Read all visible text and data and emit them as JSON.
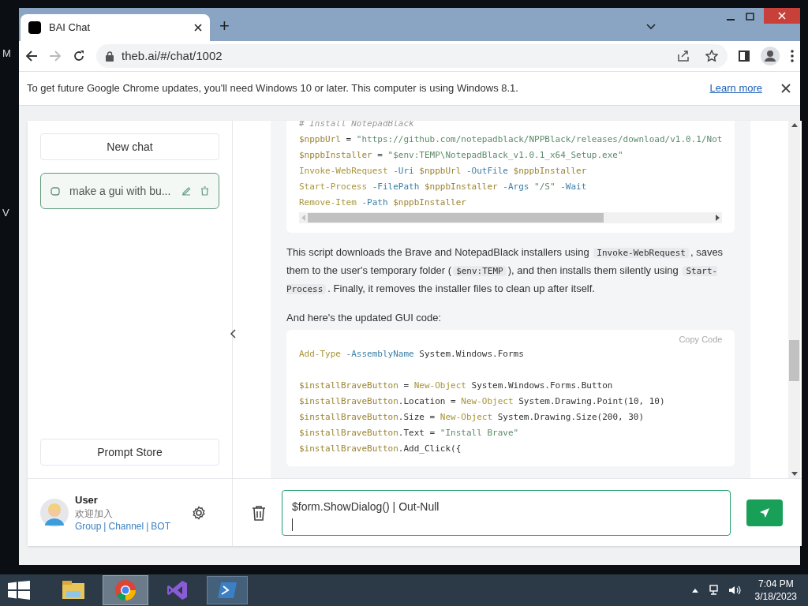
{
  "desktop": {
    "icon_labels": [
      "M",
      "V"
    ]
  },
  "browser": {
    "tabs": [
      {
        "title": "BAI Chat",
        "selected": true
      }
    ],
    "new_tab": "+",
    "url": "theb.ai/#/chat/1002",
    "infobar": {
      "text": "To get future Google Chrome updates, you'll need Windows 10 or later. This computer is using Windows 8.1.",
      "link": "Learn more"
    }
  },
  "sidebar": {
    "new_chat": "New chat",
    "chats": [
      {
        "title": "make a gui with bu...",
        "selected": true
      }
    ],
    "prompt_store": "Prompt Store",
    "user": {
      "name": "User",
      "welcome": "欢迎加入",
      "links": [
        {
          "text": "Group",
          "separator": "|"
        },
        {
          "text": "Channel",
          "separator": "|"
        },
        {
          "text": "BOT"
        }
      ]
    }
  },
  "messages": [
    {
      "kind": "code",
      "h_scroll": true,
      "lines": [
        {
          "kind": "code",
          "tokens": [
            {
              "kind": "comment",
              "t": "# Install NotepadBlack"
            }
          ]
        },
        {
          "kind": "code",
          "tokens": [
            {
              "kind": "var",
              "t": "$nppbUrl"
            },
            {
              "kind": "plain",
              "t": " = "
            },
            {
              "kind": "str",
              "t": "\"https://github.com/notepadblack/NPPBlack/releases/download/v1.0.1/Not"
            }
          ]
        },
        {
          "kind": "code",
          "tokens": [
            {
              "kind": "var",
              "t": "$nppbInstaller"
            },
            {
              "kind": "plain",
              "t": " = "
            },
            {
              "kind": "str",
              "t": "\"$env:TEMP\\NotepadBlack_v1.0.1_x64_Setup.exe\""
            }
          ]
        },
        {
          "kind": "code",
          "tokens": [
            {
              "kind": "cmd",
              "t": "Invoke-WebRequest"
            },
            {
              "kind": "param",
              "t": " -Uri "
            },
            {
              "kind": "var",
              "t": "$nppbUrl"
            },
            {
              "kind": "param",
              "t": " -OutFile "
            },
            {
              "kind": "var",
              "t": "$nppbInstaller"
            }
          ]
        },
        {
          "kind": "code",
          "tokens": [
            {
              "kind": "cmd",
              "t": "Start-Process"
            },
            {
              "kind": "param",
              "t": " -FilePath "
            },
            {
              "kind": "var",
              "t": "$nppbInstaller"
            },
            {
              "kind": "param",
              "t": " -Args "
            },
            {
              "kind": "str",
              "t": "\"/S\""
            },
            {
              "kind": "param",
              "t": " -Wait"
            }
          ]
        },
        {
          "kind": "code",
          "tokens": [
            {
              "kind": "cmd",
              "t": "Remove-Item"
            },
            {
              "kind": "param",
              "t": " -Path "
            },
            {
              "kind": "var",
              "t": "$nppbInstaller"
            }
          ]
        }
      ]
    },
    {
      "kind": "text",
      "parts": [
        {
          "kind": "text",
          "t": "This script downloads the Brave and NotepadBlack installers using "
        },
        {
          "kind": "code",
          "t": "Invoke-WebRequest"
        },
        {
          "kind": "text",
          "t": ", saves them to the user's temporary folder ("
        },
        {
          "kind": "code",
          "t": "$env:TEMP"
        },
        {
          "kind": "text",
          "t": "), and then installs them silently using "
        },
        {
          "kind": "code",
          "t": "Start-Process"
        },
        {
          "kind": "text",
          "t": ". Finally, it removes the installer files to clean up after itself."
        }
      ]
    },
    {
      "kind": "text",
      "parts": [
        {
          "kind": "text",
          "t": "And here's the updated GUI code:"
        }
      ]
    },
    {
      "kind": "code",
      "copy": "Copy  Code",
      "lines": [
        {
          "kind": "code",
          "tokens": [
            {
              "kind": "cmd",
              "t": "Add-Type"
            },
            {
              "kind": "param",
              "t": " -AssemblyName"
            },
            {
              "kind": "plain",
              "t": " System.Windows.Forms"
            }
          ]
        },
        {
          "kind": "blank"
        },
        {
          "kind": "code",
          "tokens": [
            {
              "kind": "var",
              "t": "$installBraveButton"
            },
            {
              "kind": "plain",
              "t": " = "
            },
            {
              "kind": "cmd",
              "t": "New-Object"
            },
            {
              "kind": "plain",
              "t": " System.Windows.Forms.Button"
            }
          ]
        },
        {
          "kind": "code",
          "tokens": [
            {
              "kind": "var",
              "t": "$installBraveButton"
            },
            {
              "kind": "plain",
              "t": ".Location = "
            },
            {
              "kind": "cmd",
              "t": "New-Object"
            },
            {
              "kind": "plain",
              "t": " System.Drawing.Point(10, 10)"
            }
          ]
        },
        {
          "kind": "code",
          "tokens": [
            {
              "kind": "var",
              "t": "$installBraveButton"
            },
            {
              "kind": "plain",
              "t": ".Size = "
            },
            {
              "kind": "cmd",
              "t": "New-Object"
            },
            {
              "kind": "plain",
              "t": " System.Drawing.Size(200, 30)"
            }
          ]
        },
        {
          "kind": "code",
          "tokens": [
            {
              "kind": "var",
              "t": "$installBraveButton"
            },
            {
              "kind": "plain",
              "t": ".Text = "
            },
            {
              "kind": "str",
              "t": "\"Install Brave\""
            }
          ]
        },
        {
          "kind": "code",
          "tokens": [
            {
              "kind": "var",
              "t": "$installBraveButton"
            },
            {
              "kind": "plain",
              "t": ".Add_Click({"
            }
          ]
        }
      ]
    }
  ],
  "composer": {
    "value": "$form.ShowDialog() | Out-Null"
  },
  "taskbar": {
    "apps": [
      {
        "kind": "folder",
        "selected": false
      },
      {
        "kind": "chrome",
        "selected": true
      },
      {
        "kind": "vs",
        "selected": false
      },
      {
        "kind": "powershell",
        "selected": false
      }
    ],
    "time": "7:04 PM",
    "date": "3/18/2023"
  }
}
